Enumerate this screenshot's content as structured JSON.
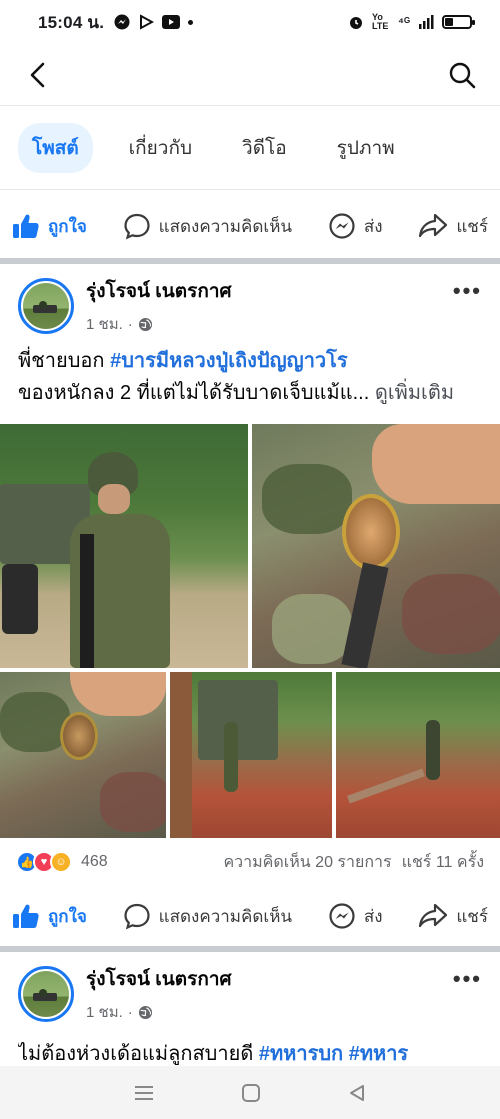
{
  "status_bar": {
    "time": "15:04 น.",
    "net_label": "Yo LTE",
    "signal_label": "⁴ᴳ",
    "battery_level": 0.3
  },
  "tabs": [
    {
      "label": "โพสต์",
      "active": true
    },
    {
      "label": "เกี่ยวกับ",
      "active": false
    },
    {
      "label": "วิดีโอ",
      "active": false
    },
    {
      "label": "รูปภาพ",
      "active": false
    }
  ],
  "action_bar": {
    "like": "ถูกใจ",
    "comment": "แสดงความคิดเห็น",
    "send": "ส่ง",
    "share": "แชร์"
  },
  "post1": {
    "author": "รุ่งโรจน์ เนตรกาศ",
    "time": "1 ชม.",
    "text_line1_prefix": "พี่ชายบอก ",
    "hashtag": "#บารมีหลวงปู่เถิงปัญญาวโร",
    "text_line2": "ของหนักลง 2 ที่แต่ไม่ได้รับบาดเจ็บแม้แ...",
    "see_more": "ดูเพิ่มเติม",
    "reaction_count": "468",
    "comments": "ความคิดเห็น 20 รายการ",
    "shares": "แชร์ 11 ครั้ง"
  },
  "post2": {
    "author": "รุ่งโรจน์ เนตรกาศ",
    "time": "1 ชม.",
    "text_prefix": "ไม่ต้องห่วงเด้อแม่ลูกสบายดี ",
    "hashtag1": "#ทหารบก",
    "hashtag2": "#ทหาร"
  },
  "icons": {
    "back": "back-arrow-icon",
    "search": "search-icon",
    "like": "thumbs-up-icon",
    "comment": "comment-bubble-icon",
    "send": "messenger-icon",
    "share": "share-arrow-icon",
    "globe": "globe-icon",
    "more": "more-dots-icon"
  },
  "colors": {
    "brand": "#1877f2",
    "hashtag": "#216fdb",
    "tab_active_bg": "#e7f3ff"
  }
}
